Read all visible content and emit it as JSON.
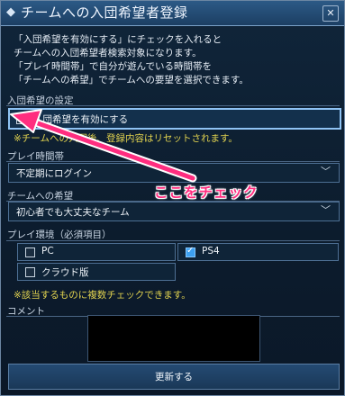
{
  "window": {
    "title": "チームへの入団希望者登録",
    "title_icon": "diamond-icon",
    "close_icon": "close-icon",
    "close_glyph": "✕"
  },
  "description": {
    "lines": [
      "「入団希望を有効にする」にチェックを入れると",
      "チームへの入団希望者検索対象になります。",
      "「プレイ時間帯」で自分が遊んでいる時間帯を",
      "「チームへの希望」でチームへの要望を選択できます。"
    ]
  },
  "entry_settings": {
    "label": "入団希望の設定",
    "checkbox_label": "入団希望を有効にする",
    "checked": false,
    "notice": "※チームへの入団後、登録内容はリセットされます。"
  },
  "play_time": {
    "label": "プレイ時間帯",
    "value": "不定期にログイン"
  },
  "team_wish": {
    "label": "チームへの希望",
    "value": "初心者でも大丈夫なチーム"
  },
  "play_env": {
    "label": "プレイ環境（必須項目）",
    "options": [
      {
        "label": "PC",
        "checked": false
      },
      {
        "label": "PS4",
        "checked": true
      },
      {
        "label": "クラウド版",
        "checked": false
      }
    ],
    "notice": "※該当するものに複数チェックできます。"
  },
  "comment": {
    "label": "コメント",
    "value": ""
  },
  "update_button": {
    "label": "更新する"
  },
  "annotation": {
    "text": "ここをチェック",
    "color": "#ff2d7f"
  },
  "colors": {
    "accent": "#3da0f0",
    "notice": "#e2d34f",
    "title_bar": "#2c5a86"
  }
}
